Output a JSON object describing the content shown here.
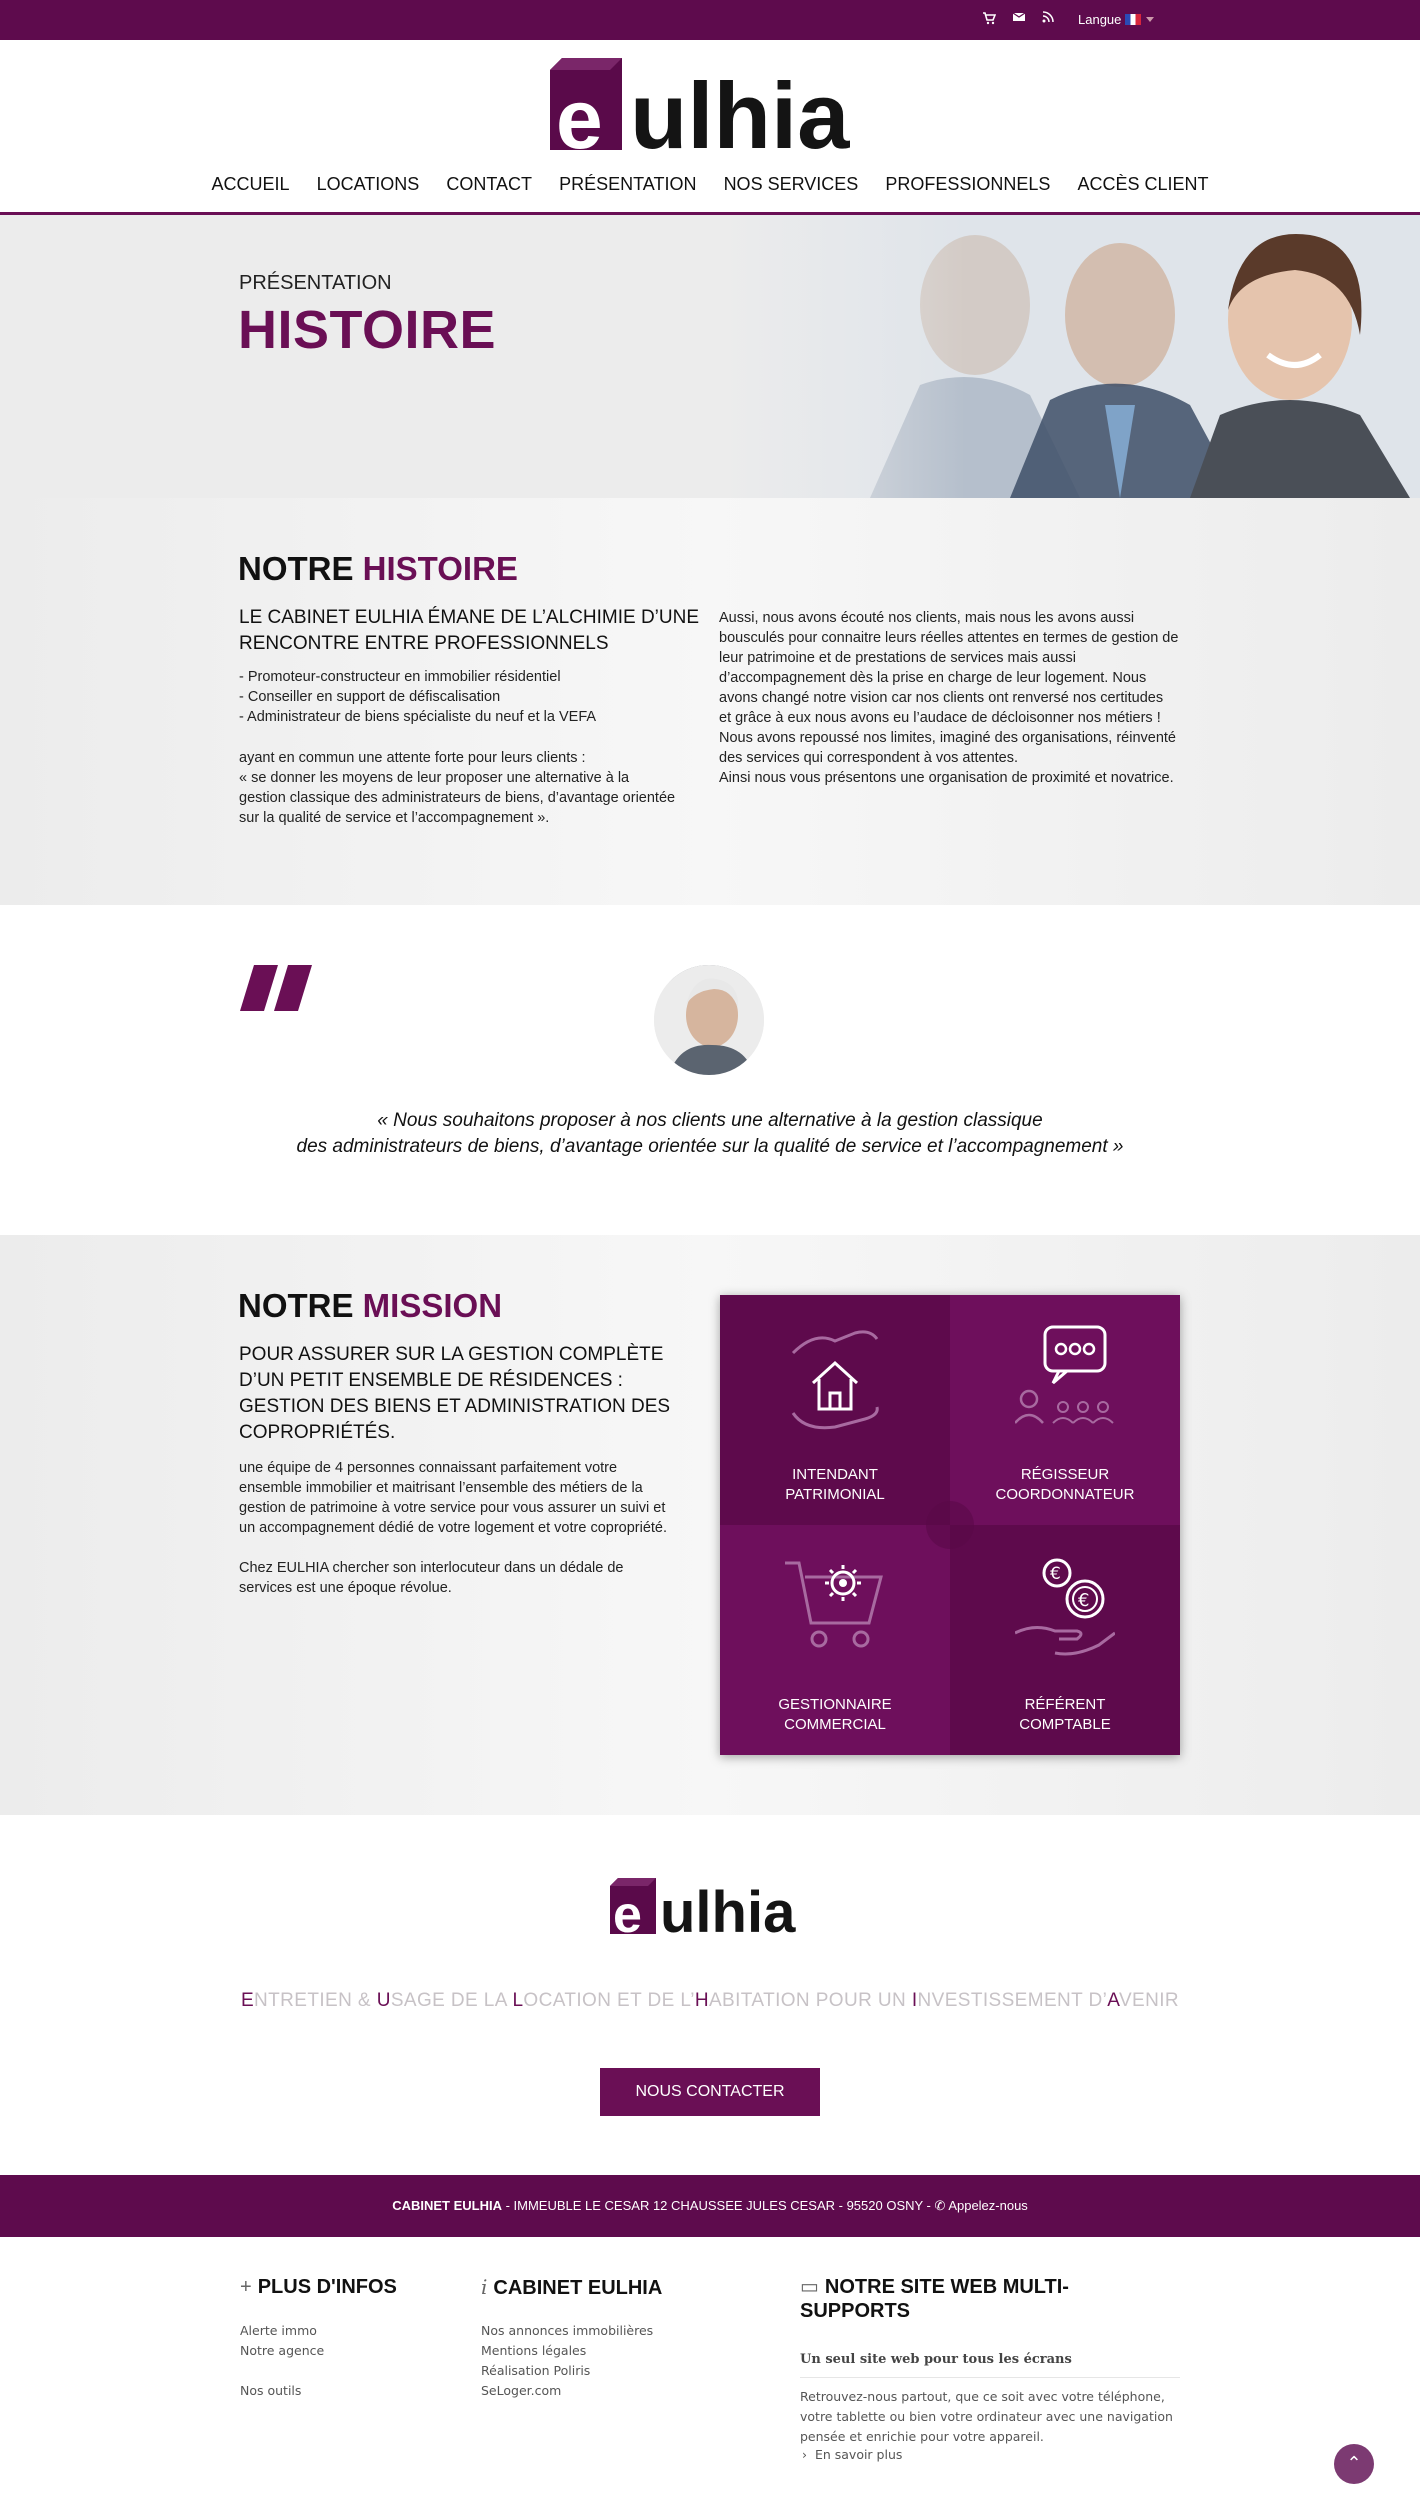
{
  "topbar": {
    "cart_icon": "cart-icon",
    "mail_icon": "mail-icon",
    "rss_icon": "rss-icon",
    "language_label": "Langue"
  },
  "header": {
    "logo_text": "eulhia",
    "nav": [
      "ACCUEIL",
      "LOCATIONS",
      "CONTACT",
      "PRÉSENTATION",
      "NOS SERVICES",
      "PROFESSIONNELS",
      "ACCÈS CLIENT"
    ]
  },
  "hero": {
    "kicker": "PRÉSENTATION",
    "title": "HISTOIRE"
  },
  "histoire": {
    "title_a": "NOTRE",
    "title_b": "HISTOIRE",
    "subhead": "LE CABINET EULHIA ÉMANE DE L’ALCHIMIE D’UNE RENCONTRE ENTRE PROFESSIONNELS",
    "bullets": [
      "- Promoteur-constructeur en immobilier résidentiel",
      "- Conseiller en support de défiscalisation",
      "- Administrateur de biens spécialiste du neuf et la VEFA"
    ],
    "para1": "ayant en commun une attente forte pour leurs clients :",
    "para2": "« se donner les moyens de leur proposer une alternative à la gestion classique des administrateurs de biens, d’avantage orientée sur la qualité de service et l’accompagnement ».",
    "right1": "Aussi, nous avons écouté nos clients, mais nous les avons aussi bousculés pour connaitre leurs réelles attentes en termes de gestion de leur patrimoine et de prestations de services mais aussi d’accompagnement dès la prise en charge de leur logement. Nous avons changé notre vision car nos clients ont renversé nos certitudes et grâce à eux nous avons eu l’audace de décloisonner nos métiers !",
    "right2": "Nous avons repoussé nos limites, imaginé des organisations, réinventé des services qui correspondent à vos attentes.",
    "right3": "Ainsi nous vous présentons une organisation de proximité et novatrice."
  },
  "quote": {
    "line1": "« Nous souhaitons proposer à nos clients une alternative à la gestion classique",
    "line2": "des administrateurs de biens, d’avantage orientée sur la qualité de service et l’accompagnement »"
  },
  "mission": {
    "title_a": "NOTRE",
    "title_b": "MISSION",
    "subhead1": "POUR ASSURER SUR LA GESTION COMPLÈTE  D’UN PETIT ENSEMBLE DE RÉSIDENCES :",
    "subhead2": "GESTION DES BIENS ET ADMINISTRATION DES COPROPRIÉTÉS.",
    "para1": "une équipe de 4 personnes connaissant parfaitement votre ensemble immobilier et maitrisant l’ensemble des métiers de la gestion de patrimoine à votre service pour vous assurer un suivi et un accompagnement dédié de votre logement et votre copropriété.",
    "para2": "Chez EULHIA chercher son interlocuteur dans un dédale de services est une époque révolue.",
    "tiles": [
      {
        "line1": "INTENDANT",
        "line2": "PATRIMONIAL",
        "icon": "house-hands-icon"
      },
      {
        "line1": "RÉGISSEUR",
        "line2": "COORDONNATEUR",
        "icon": "speech-people-icon"
      },
      {
        "line1": "GESTIONNAIRE",
        "line2": "COMMERCIAL",
        "icon": "cart-gear-icon"
      },
      {
        "line1": "RÉFÉRENT",
        "line2": "COMPTABLE",
        "icon": "euro-hand-icon"
      }
    ],
    "colors": {
      "tile_dark": "#5e0a4c",
      "tile_light": "#6e0f5c"
    }
  },
  "brand": {
    "tagline_parts": [
      [
        "E",
        "NTRETIEN & "
      ],
      [
        "U",
        "SAGE DE LA "
      ],
      [
        "L",
        "OCATION ET DE L’"
      ],
      [
        "H",
        "ABITATION POUR UN "
      ],
      [
        "I",
        "NVESTISSEMENT D’"
      ],
      [
        "A",
        "VENIR"
      ]
    ],
    "cta": "NOUS CONTACTER"
  },
  "address": {
    "company": "CABINET EULHIA",
    "details": " - IMMEUBLE LE CESAR 12 CHAUSSEE JULES CESAR - 95520 OSNY - ",
    "phone": "Appelez-nous"
  },
  "footer": {
    "col1_title": "PLUS D'INFOS",
    "col1_links": [
      "Alerte immo",
      "Notre agence",
      "",
      "Nos outils"
    ],
    "col2_title": "CABINET EULHIA",
    "col2_links": [
      "Nos annonces immobilières",
      "Mentions légales",
      "Réalisation Poliris",
      "SeLoger.com"
    ],
    "col3_title": "NOTRE SITE WEB MULTI-SUPPORTS",
    "col3_sub": "Un seul site web pour tous les écrans",
    "col3_text": "Retrouvez-nous partout, que ce soit avec votre téléphone, votre tablette ou bien votre ordinateur avec une navigation pensée et enrichie pour votre appareil.",
    "col3_more": "En savoir plus"
  },
  "colors": {
    "brand": "#6a0f55",
    "bar": "#5e0b4d"
  }
}
